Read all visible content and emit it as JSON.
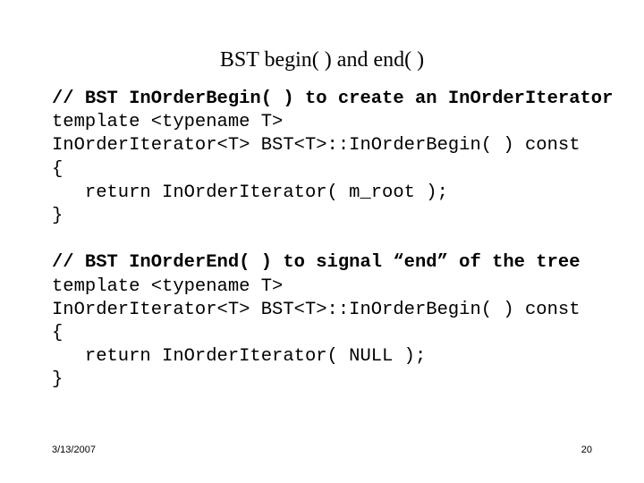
{
  "slide": {
    "title": "BST begin( ) and end( )",
    "background_color": "#ffffff",
    "text_color": "#000000",
    "code_lines": [
      {
        "text": "// BST InOrderBegin( ) to create an InOrderIterator",
        "bold": true
      },
      {
        "text": "template <typename T>",
        "bold": false
      },
      {
        "text": "InOrderIterator<T> BST<T>::InOrderBegin( ) const",
        "bold": false
      },
      {
        "text": "{",
        "bold": false
      },
      {
        "text": "   return InOrderIterator( m_root );",
        "bold": false
      },
      {
        "text": "}",
        "bold": false
      },
      {
        "text": "",
        "bold": false
      },
      {
        "text": "// BST InOrderEnd( ) to signal “end” of the tree",
        "bold": true
      },
      {
        "text": "template <typename T>",
        "bold": false
      },
      {
        "text": "InOrderIterator<T> BST<T>::InOrderBegin( ) const",
        "bold": false
      },
      {
        "text": "{",
        "bold": false
      },
      {
        "text": "   return InOrderIterator( NULL );",
        "bold": false
      },
      {
        "text": "}",
        "bold": false
      }
    ],
    "footer": {
      "date": "3/13/2007",
      "page_number": "20"
    }
  }
}
